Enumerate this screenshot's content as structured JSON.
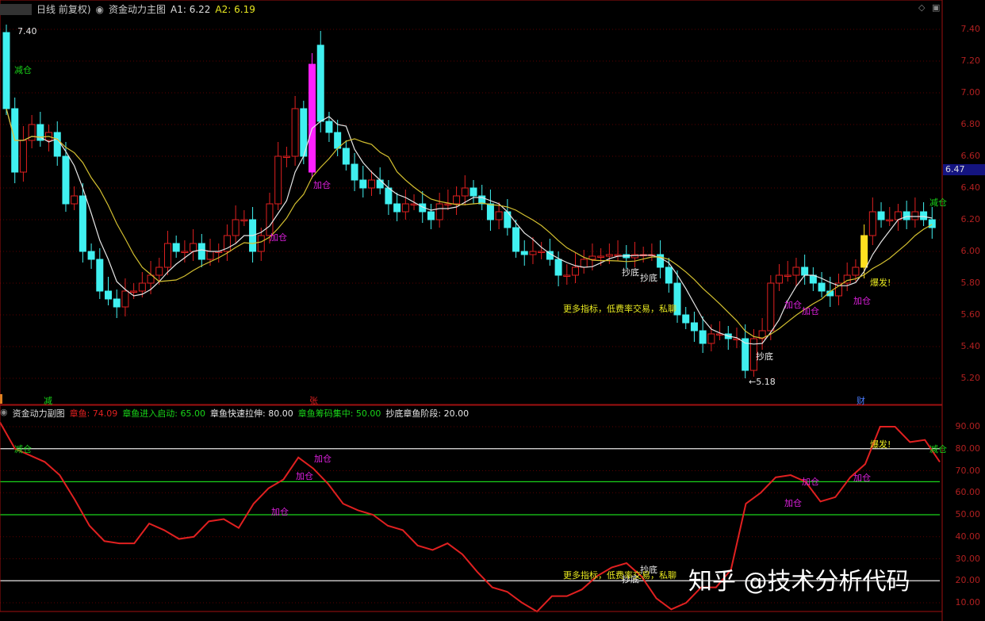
{
  "header": {
    "period": "日线 前复权)",
    "indicator": "资金动力主图",
    "a1": "A1: 6.22",
    "a2": "A2: 6.19"
  },
  "sub_header": {
    "title": "资金动力副图",
    "items": [
      {
        "label": "章鱼: 74.09",
        "color": "#e02020"
      },
      {
        "label": "章鱼进入启动: 65.00",
        "color": "#19d419"
      },
      {
        "label": "章鱼快速拉伸: 80.00",
        "color": "#e6e6e6"
      },
      {
        "label": "章鱼筹码集中: 50.00",
        "color": "#19d419"
      },
      {
        "label": "抄底章鱼阶段: 20.00",
        "color": "#e6e6e6"
      }
    ]
  },
  "price_tag": "6.47",
  "max_label": "7.40",
  "min_label": "←5.18",
  "markers": {
    "jian": "减",
    "zhang": "张",
    "cai": "财"
  },
  "annotations": {
    "jiancang": "减仓",
    "jiacang": "加仓",
    "chaodi": "抄底",
    "baofa": "爆发!",
    "promo": "更多指标，低费率交易，私聊"
  },
  "watermark": "知乎 @技术分析代码",
  "colors": {
    "up": "#e02020",
    "down": "#40f0f0",
    "ma5": "#e6e6e6",
    "ma10": "#d4c030",
    "special_up": "#ff20ff",
    "special_yellow": "#ffe020",
    "grid": "#5a0000"
  },
  "chart_data": [
    {
      "type": "candlestick",
      "title": "资金动力主图",
      "ylim": [
        5.1,
        7.5
      ],
      "yticks": [
        "7.40",
        "7.20",
        "7.00",
        "6.80",
        "6.60",
        "6.40",
        "6.20",
        "6.00",
        "5.80",
        "5.60",
        "5.40",
        "5.20"
      ],
      "closes": [
        6.9,
        6.5,
        6.7,
        6.8,
        6.7,
        6.75,
        6.6,
        6.3,
        6.35,
        6.0,
        5.95,
        5.75,
        5.7,
        5.65,
        5.75,
        5.75,
        5.8,
        5.85,
        5.9,
        6.05,
        6.0,
        6.0,
        6.05,
        5.95,
        6.0,
        6.0,
        6.1,
        6.2,
        6.2,
        6.0,
        6.1,
        6.3,
        6.6,
        6.6,
        6.9,
        6.6,
        7.18,
        6.82,
        6.75,
        6.65,
        6.55,
        6.45,
        6.4,
        6.45,
        6.4,
        6.3,
        6.25,
        6.3,
        6.3,
        6.25,
        6.2,
        6.3,
        6.3,
        6.35,
        6.4,
        6.35,
        6.3,
        6.2,
        6.25,
        6.15,
        6.0,
        5.98,
        6.0,
        6.0,
        5.95,
        5.85,
        5.85,
        5.9,
        5.95,
        5.97,
        5.97,
        5.98,
        5.98,
        5.96,
        5.98,
        5.98,
        5.98,
        5.9,
        5.8,
        5.6,
        5.55,
        5.5,
        5.42,
        5.48,
        5.48,
        5.45,
        5.45,
        5.25,
        5.45,
        5.5,
        5.8,
        5.85,
        5.85,
        5.9,
        5.85,
        5.8,
        5.75,
        5.72,
        5.8,
        5.85,
        5.9,
        6.1,
        6.25,
        6.2,
        6.2,
        6.25,
        6.2,
        6.25,
        6.2,
        6.15
      ],
      "opens_override": {
        "0": 7.38,
        "36": 6.5,
        "37": 7.3,
        "101": 5.9
      },
      "special": {
        "36": "special_up",
        "101": "special_yellow"
      },
      "ma_periods": [
        5,
        10
      ]
    },
    {
      "type": "line",
      "title": "资金动力副图",
      "ylim": [
        5,
        95
      ],
      "yticks": [
        "90.00",
        "80.00",
        "70.00",
        "60.00",
        "50.00",
        "40.00",
        "30.00",
        "20.00",
        "10.00"
      ],
      "series": [
        {
          "name": "章鱼",
          "values": [
            92,
            80,
            77,
            74,
            68,
            57,
            45,
            38,
            37,
            37,
            46,
            43,
            39,
            40,
            47,
            48,
            44,
            55,
            62,
            66,
            76,
            71,
            64,
            55,
            52,
            50,
            45,
            43,
            36,
            34,
            37,
            32,
            24,
            17,
            15,
            10,
            6,
            13,
            13,
            16,
            22,
            26,
            28,
            22,
            12,
            7,
            10,
            17,
            17,
            25,
            55,
            60,
            67,
            68,
            65,
            56,
            58,
            67,
            73,
            90,
            90,
            83,
            84,
            74
          ]
        }
      ],
      "hlines": [
        {
          "value": 80,
          "color": "#e6e6e6"
        },
        {
          "value": 65,
          "color": "#19d419"
        },
        {
          "value": 50,
          "color": "#19d419"
        },
        {
          "value": 20,
          "color": "#e6e6e6"
        }
      ]
    }
  ]
}
